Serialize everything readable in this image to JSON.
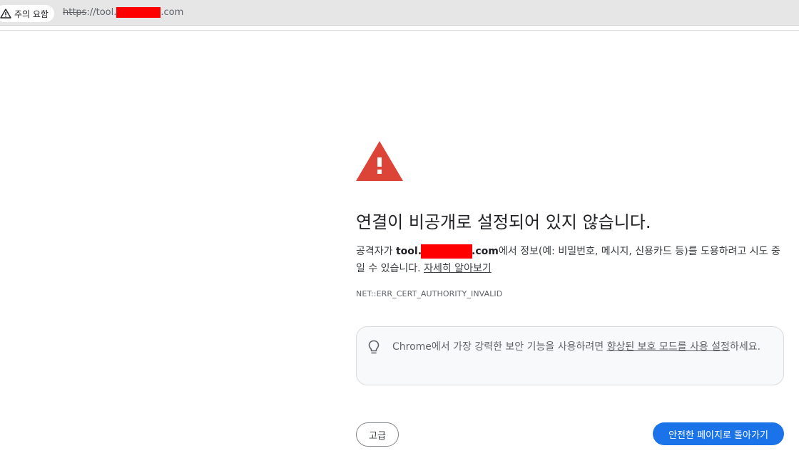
{
  "address_bar": {
    "security_chip_label": "주의 요함",
    "security_chip_icon": "warning-triangle-outline-icon",
    "url_scheme": "https",
    "url_scheme_separator": "://",
    "url_host_prefix": "tool.",
    "url_host_suffix": ".com"
  },
  "interstitial": {
    "warning_icon": "red-warning-triangle-icon",
    "warning_color": "#db4437",
    "heading": "연결이 비공개로 설정되어 있지 않습니다.",
    "explanation": {
      "prefix": "공격자가 ",
      "host_prefix": "tool.",
      "host_suffix": ".com",
      "middle": "에서 정보(예: 비밀번호, 메시지, 신용카드 등)를 도용하려고 시도 중일 수 있습니다. ",
      "learn_more_link": "자세히 알아보기"
    },
    "error_code": "NET::ERR_CERT_AUTHORITY_INVALID",
    "enhanced_protection": {
      "icon": "lightbulb-icon",
      "prefix": "Chrome에서 가장 강력한 보안 기능을 사용하려면 ",
      "link": "향상된 보호 모드를 사용 설정",
      "suffix": "하세요."
    },
    "advanced_button_label": "고급",
    "back_button_label": "안전한 페이지로 돌아가기",
    "accent_color": "#1a73e8"
  }
}
